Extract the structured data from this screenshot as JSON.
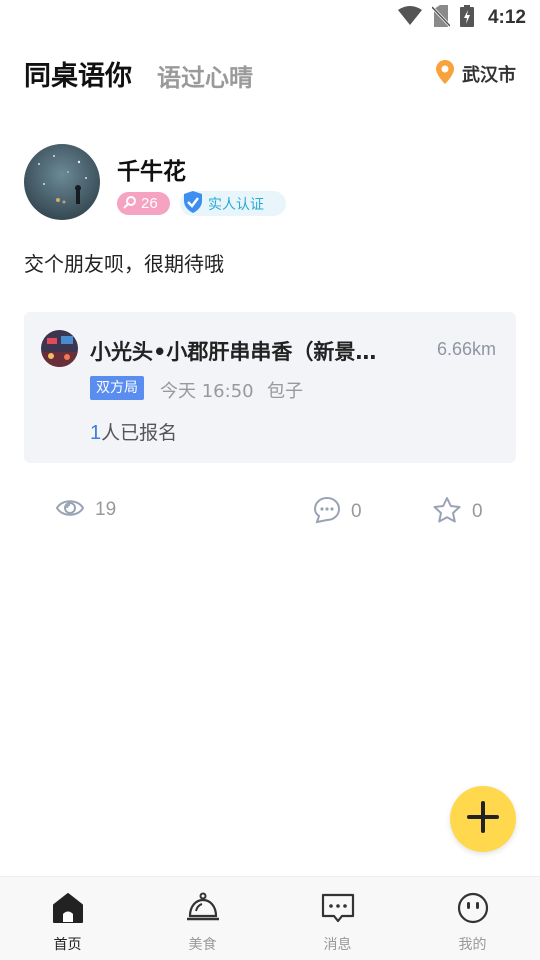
{
  "status_bar": {
    "time": "4:12",
    "icons": [
      "wifi-icon",
      "no-sim-icon",
      "battery-charging-icon"
    ]
  },
  "header": {
    "app_title": "同桌语你",
    "slogan": "语过心晴",
    "location": "武汉市",
    "location_icon": "location-pin-icon"
  },
  "user": {
    "name": "千牛花",
    "level": "26",
    "verified_label": "实人认证"
  },
  "post": {
    "text": "交个朋友呗，很期待哦"
  },
  "event": {
    "shop_name": "小光头•小郡肝串串香（新景…",
    "distance": "6.66km",
    "type_tag": "双方局",
    "time": "今天 16:50",
    "host": "包子",
    "signup_count": "1",
    "signup_text": "人已报名"
  },
  "stats": {
    "views": "19",
    "comments": "0",
    "favorites": "0"
  },
  "nav": {
    "items": [
      {
        "label": "首页",
        "icon": "home-icon",
        "active": true
      },
      {
        "label": "美食",
        "icon": "service-bell-icon",
        "active": false
      },
      {
        "label": "消息",
        "icon": "message-icon",
        "active": false
      },
      {
        "label": "我的",
        "icon": "profile-face-icon",
        "active": false
      }
    ]
  },
  "colors": {
    "accent_yellow": "#ffd84d",
    "tag_blue": "#5a8df0",
    "level_pink": "#f5a3c0",
    "verify_blue": "#2aa8d6",
    "location_orange": "#f7a23b"
  }
}
